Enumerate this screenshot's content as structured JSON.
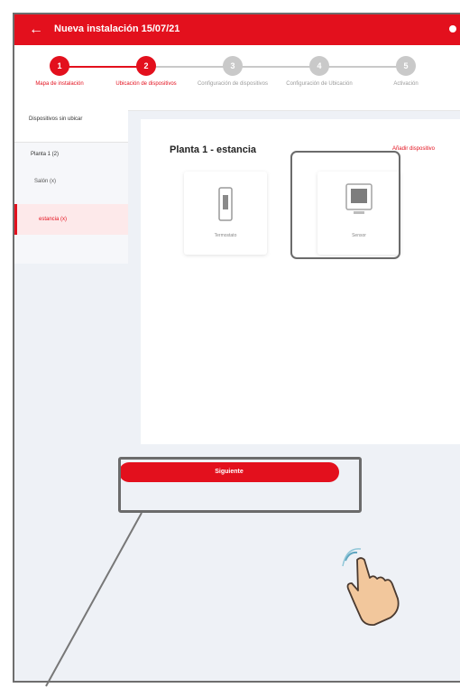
{
  "app": {
    "title": "Nueva instalación 15/07/21"
  },
  "steps": [
    {
      "number": "1",
      "label": "Mapa de instalación",
      "state": "done"
    },
    {
      "number": "2",
      "label": "Ubicación de dispositivos",
      "state": "active"
    },
    {
      "number": "3",
      "label": "Configuración de dispositivos",
      "state": "pending"
    },
    {
      "number": "4",
      "label": "Configuración de Ubicación",
      "state": "pending"
    },
    {
      "number": "5",
      "label": "Activación",
      "state": "pending"
    }
  ],
  "sidebar": {
    "header": "Dispositivos sin ubicar",
    "floor": "Planta 1 (2)",
    "items": [
      "Salón (x)",
      "estancia (x)"
    ]
  },
  "main": {
    "room_title": "Planta 1 - estancia",
    "link_label": "Añadir dispositivo",
    "devices": [
      {
        "label": "Termostato"
      },
      {
        "label": "Sensor"
      }
    ]
  },
  "footer": {
    "next_label": "Siguiente"
  },
  "colors": {
    "accent": "#e3101d",
    "highlight_border": "#6b6b6b"
  },
  "icons": {
    "back": "arrow-left-icon",
    "pointer": "hand-pointer-icon"
  }
}
